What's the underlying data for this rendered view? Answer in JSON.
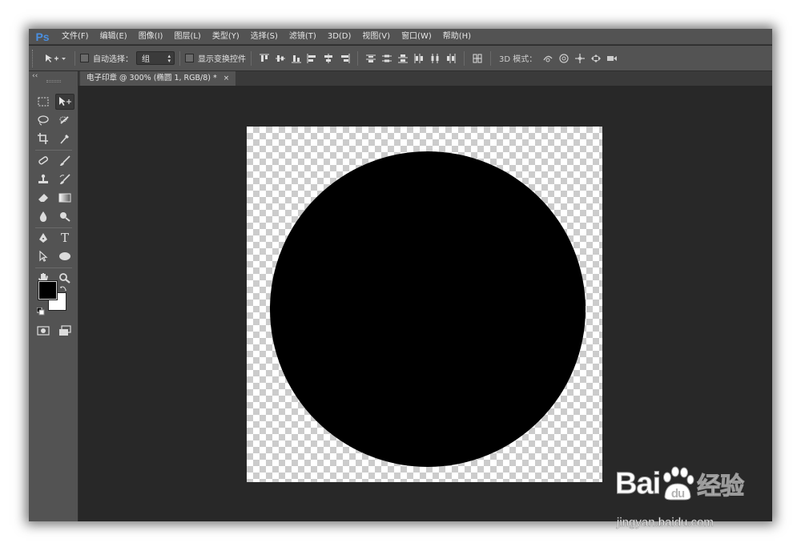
{
  "app": {
    "logo": "Ps",
    "menus": [
      "文件(F)",
      "编辑(E)",
      "图像(I)",
      "图层(L)",
      "类型(Y)",
      "选择(S)",
      "滤镜(T)",
      "3D(D)",
      "视图(V)",
      "窗口(W)",
      "帮助(H)"
    ]
  },
  "options": {
    "auto_select_label": "自动选择：",
    "auto_select_value": "组",
    "show_transform_label": "显示变换控件",
    "mode_3d_label": "3D 模式："
  },
  "tools": {
    "collapse_glyph": "‹‹",
    "type_glyph": "T"
  },
  "document": {
    "tab_title": "电子印章 @ 300% (椭圆 1, RGB/8) *",
    "close_glyph": "×"
  },
  "watermark": {
    "brand_left": "Bai",
    "brand_right": "经验",
    "url": "jingyan.baidu.com"
  },
  "colors": {
    "ui_panel": "#535353",
    "workspace": "#282828",
    "foreground": "#000000",
    "background": "#ffffff",
    "shape_fill": "#000000"
  }
}
